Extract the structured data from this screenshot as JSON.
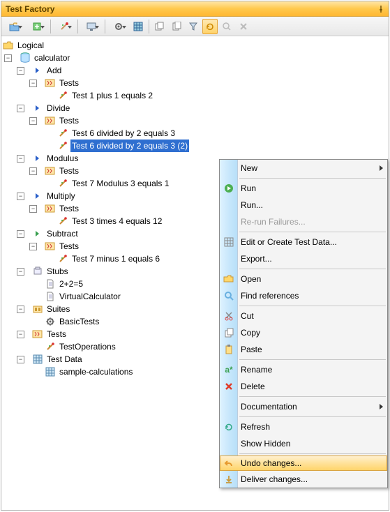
{
  "window": {
    "title": "Test Factory"
  },
  "toolbar": {
    "buttons": [
      {
        "name": "open-folder",
        "dd": true,
        "hl": false
      },
      {
        "name": "new-item",
        "dd": true,
        "hl": false
      },
      {
        "name": "wand",
        "dd": true,
        "hl": false
      },
      {
        "name": "monitor",
        "dd": true,
        "hl": false
      },
      {
        "name": "gear",
        "dd": true,
        "hl": false
      },
      {
        "name": "grid-blue",
        "dd": false,
        "hl": false
      }
    ],
    "buttons2": [
      {
        "name": "copy-multi",
        "dd": false,
        "hl": false
      },
      {
        "name": "copy",
        "dd": false,
        "hl": false
      },
      {
        "name": "filter",
        "dd": false,
        "hl": false
      },
      {
        "name": "sync",
        "dd": false,
        "hl": true
      },
      {
        "name": "search",
        "dd": false,
        "hl": false,
        "disabled": true
      },
      {
        "name": "close",
        "dd": false,
        "hl": false,
        "disabled": true
      }
    ]
  },
  "tree": {
    "root_label": "Logical",
    "nodes": [
      {
        "depth": 1,
        "toggle": "-",
        "icon": "db",
        "label": "calculator"
      },
      {
        "depth": 2,
        "toggle": "-",
        "icon": "chev-blue",
        "label": "Add"
      },
      {
        "depth": 3,
        "toggle": "-",
        "icon": "tests",
        "label": "Tests"
      },
      {
        "depth": 4,
        "toggle": "",
        "icon": "wand",
        "label": "Test 1 plus 1 equals 2"
      },
      {
        "depth": 2,
        "toggle": "-",
        "icon": "chev-blue",
        "label": "Divide"
      },
      {
        "depth": 3,
        "toggle": "-",
        "icon": "tests",
        "label": "Tests"
      },
      {
        "depth": 4,
        "toggle": "",
        "icon": "wand",
        "label": "Test 6 divided by  2 equals 3"
      },
      {
        "depth": 4,
        "toggle": "",
        "icon": "wand",
        "label": "Test 6 divided by  2 equals 3 (2)",
        "selected": true
      },
      {
        "depth": 2,
        "toggle": "-",
        "icon": "chev-blue",
        "label": "Modulus"
      },
      {
        "depth": 3,
        "toggle": "-",
        "icon": "tests",
        "label": "Tests"
      },
      {
        "depth": 4,
        "toggle": "",
        "icon": "wand",
        "label": "Test 7 Modulus 3 equals 1"
      },
      {
        "depth": 2,
        "toggle": "-",
        "icon": "chev-blue",
        "label": "Multiply"
      },
      {
        "depth": 3,
        "toggle": "-",
        "icon": "tests",
        "label": "Tests"
      },
      {
        "depth": 4,
        "toggle": "",
        "icon": "wand",
        "label": "Test 3 times 4 equals 12"
      },
      {
        "depth": 2,
        "toggle": "-",
        "icon": "chev-green",
        "label": "Subtract"
      },
      {
        "depth": 3,
        "toggle": "-",
        "icon": "tests",
        "label": "Tests"
      },
      {
        "depth": 4,
        "toggle": "",
        "icon": "wand",
        "label": "Test 7 minus 1 equals 6"
      },
      {
        "depth": 2,
        "toggle": "-",
        "icon": "stubs",
        "label": "Stubs"
      },
      {
        "depth": 3,
        "toggle": "",
        "icon": "page",
        "label": "2+2=5"
      },
      {
        "depth": 3,
        "toggle": "",
        "icon": "page",
        "label": "VirtualCalculator"
      },
      {
        "depth": 2,
        "toggle": "-",
        "icon": "suite",
        "label": "Suites"
      },
      {
        "depth": 3,
        "toggle": "",
        "icon": "gear",
        "label": "BasicTests"
      },
      {
        "depth": 2,
        "toggle": "-",
        "icon": "tests",
        "label": "Tests"
      },
      {
        "depth": 3,
        "toggle": "",
        "icon": "wand",
        "label": "TestOperations"
      },
      {
        "depth": 2,
        "toggle": "-",
        "icon": "grid",
        "label": "Test Data"
      },
      {
        "depth": 3,
        "toggle": "",
        "icon": "grid",
        "label": "sample-calculations"
      }
    ]
  },
  "context_menu": {
    "items": [
      {
        "label": "New",
        "submenu": true
      },
      {
        "sep": true
      },
      {
        "label": "Run",
        "icon": "play-green"
      },
      {
        "label": "Run..."
      },
      {
        "label": "Re-run Failures...",
        "disabled": true
      },
      {
        "sep": true
      },
      {
        "label": "Edit or Create Test Data...",
        "icon": "grid"
      },
      {
        "label": "Export..."
      },
      {
        "sep": true
      },
      {
        "label": "Open",
        "icon": "folder-open"
      },
      {
        "label": "Find references",
        "icon": "search"
      },
      {
        "sep": true
      },
      {
        "label": "Cut",
        "icon": "cut"
      },
      {
        "label": "Copy",
        "icon": "copy"
      },
      {
        "label": "Paste",
        "icon": "paste"
      },
      {
        "sep": true
      },
      {
        "label": "Rename",
        "icon": "rename"
      },
      {
        "label": "Delete",
        "icon": "delete-red"
      },
      {
        "sep": true
      },
      {
        "label": "Documentation",
        "submenu": true
      },
      {
        "sep": true
      },
      {
        "label": "Refresh",
        "icon": "refresh"
      },
      {
        "label": "Show Hidden"
      },
      {
        "sep": true
      },
      {
        "label": "Undo changes...",
        "icon": "undo",
        "hover": true
      },
      {
        "label": "Deliver changes...",
        "icon": "deliver"
      }
    ]
  }
}
